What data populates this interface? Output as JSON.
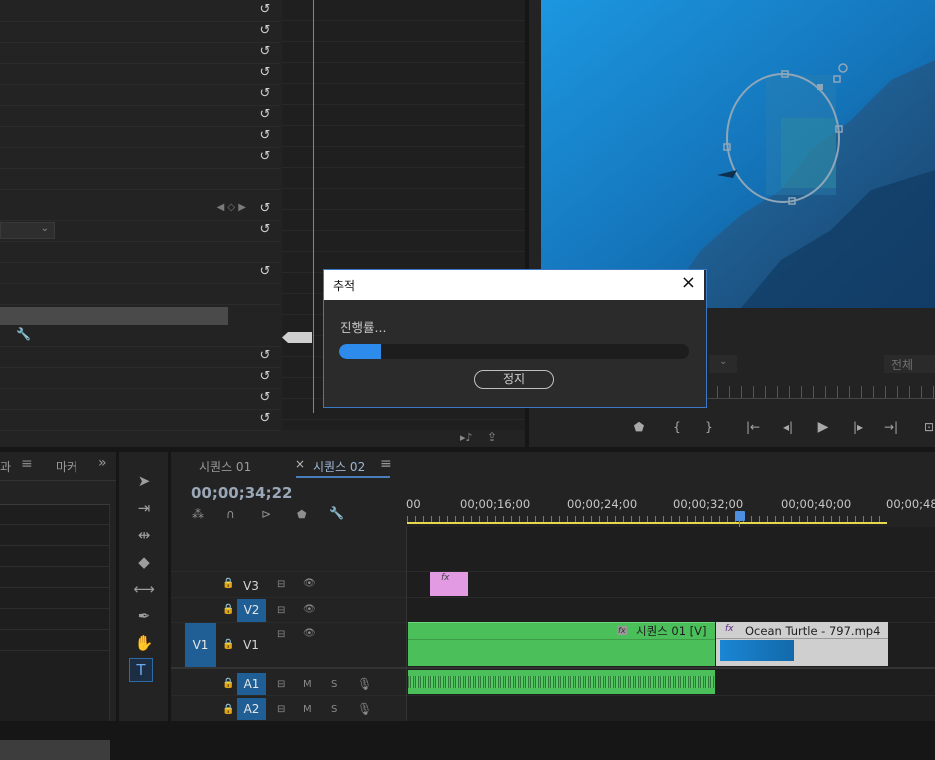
{
  "dialog": {
    "title": "추적",
    "progress_label": "진행률...",
    "progress_fraction": 0.12,
    "stop_button": "정지"
  },
  "monitor": {
    "fit_label": "전체"
  },
  "project_panel": {
    "tab_partial_1": "과",
    "tab_partial_2": "마커",
    "more_chevron": "»"
  },
  "timeline": {
    "tabs": [
      {
        "label": "시퀀스 01"
      },
      {
        "label": "시퀀스 02",
        "active": true
      }
    ],
    "close_mark": "×",
    "menu_mark": "≡",
    "timecode": "00;00;34;22",
    "ruler": [
      "00",
      "00;00;16;00",
      "00;00;24;00",
      "00;00;32;00",
      "00;00;40;00",
      "00;00;48"
    ],
    "tracks": {
      "video": [
        {
          "label": "V3",
          "targeted": false
        },
        {
          "label": "V2",
          "targeted": true
        },
        {
          "label": "V1",
          "targeted": false,
          "source": "V1"
        }
      ],
      "audio": [
        {
          "label": "A1",
          "targeted": true,
          "m": "M",
          "s": "S"
        },
        {
          "label": "A2",
          "targeted": true,
          "m": "M",
          "s": "S"
        }
      ]
    },
    "clips": {
      "seq_clip": "시퀀스 01 [V]",
      "turtle_clip": "Ocean Turtle - 797.mp4",
      "fx": "fx"
    }
  },
  "colors": {
    "accent": "#2d8ceb",
    "clip_green": "#4bbf5a",
    "clip_pink": "#e29ae2",
    "playhead": "#4d8fe0",
    "yellow_bar": "#e6d84a"
  }
}
